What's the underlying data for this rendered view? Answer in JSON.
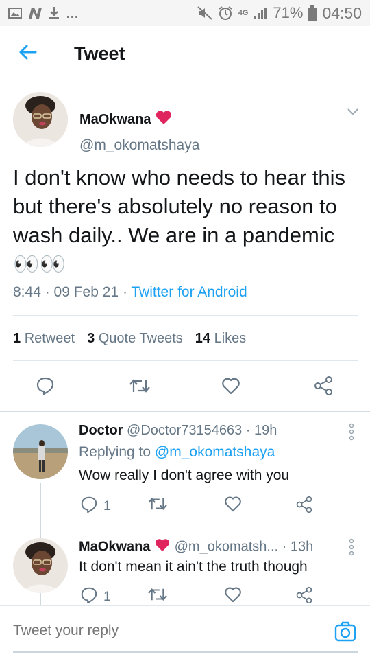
{
  "status_bar": {
    "network": "4G",
    "battery": "71%",
    "time": "04:50",
    "overflow": "..."
  },
  "header": {
    "title": "Tweet"
  },
  "tweet": {
    "author_name": "MaOkwana",
    "author_handle": "@m_okomatshaya",
    "text": "I don't know who needs to hear this but there's absolutely no reason to wash daily.. We are in a pandemic👀👀",
    "time": "8:44 · 09 Feb 21 · ",
    "source": "Twitter for Android",
    "stats": {
      "retweets_count": "1",
      "retweets_label": "Retweet",
      "quotes_count": "3",
      "quotes_label": "Quote Tweets",
      "likes_count": "14",
      "likes_label": "Likes"
    }
  },
  "replies": [
    {
      "name": "Doctor",
      "handle": "@Doctor73154663",
      "time": "· 19h",
      "replying_to_label": "Replying to",
      "replying_to": "@m_okomatshaya",
      "text": "Wow really I don't agree with you",
      "reply_count": "1"
    },
    {
      "name": "MaOkwana",
      "handle": "@m_okomatsh...",
      "time": "· 13h",
      "text": "It don't mean it ain't the truth though",
      "reply_count": "1"
    }
  ],
  "reply_bar": {
    "placeholder": "Tweet your reply"
  },
  "colors": {
    "accent": "#1da1f2",
    "heart": "#e0245e",
    "secondary_text": "#657786"
  }
}
